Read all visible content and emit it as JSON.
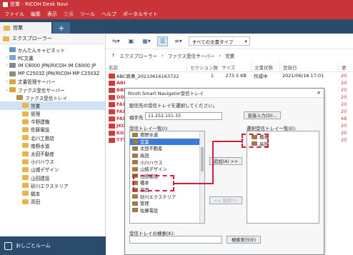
{
  "app": {
    "title": "営業 - RICOH Desk Navi"
  },
  "menu": {
    "items": [
      "ファイル",
      "編集",
      "表示",
      "文書",
      "ツール",
      "ヘルプ",
      "ポータルサイト"
    ]
  },
  "tab": {
    "label": "営業",
    "add": "+"
  },
  "left": {
    "header": "エクスプローラー",
    "tree": [
      {
        "label": "かんたんキャビネット",
        "icon": "cabinet-icon",
        "arrow": ""
      },
      {
        "label": "PC文書",
        "icon": "pc-icon",
        "arrow": "›"
      },
      {
        "label": "IM C6000 JPN(RICOH IM C6000 JP",
        "icon": "printer-icon",
        "arrow": "›"
      },
      {
        "label": "MP C2503Z JPN(RICOH MP C2503Z",
        "icon": "printer-icon",
        "arrow": "›"
      },
      {
        "label": "文書管理サーバー",
        "icon": "server-icon",
        "arrow": "›"
      },
      {
        "label": "ファクス受信サーバー",
        "icon": "fax-server-icon",
        "arrow": "⌄"
      },
      {
        "label": "ファクス受信トレイ",
        "icon": "tray-icon",
        "arrow": ""
      },
      {
        "label": "営業",
        "icon": "folder-icon",
        "arrow": ""
      },
      {
        "label": "管理",
        "icon": "folder-icon",
        "arrow": ""
      },
      {
        "label": "今野建機",
        "icon": "folder-icon",
        "arrow": ""
      },
      {
        "label": "佐藤電設",
        "icon": "folder-icon",
        "arrow": ""
      },
      {
        "label": "北川工務店",
        "icon": "folder-icon",
        "arrow": ""
      },
      {
        "label": "南野水道",
        "icon": "folder-icon",
        "arrow": ""
      },
      {
        "label": "太田不動産",
        "icon": "folder-icon",
        "arrow": ""
      },
      {
        "label": "小川ハウス",
        "icon": "folder-icon",
        "arrow": ""
      },
      {
        "label": "山城デザイン",
        "icon": "folder-icon",
        "arrow": ""
      },
      {
        "label": "山田建設",
        "icon": "folder-icon",
        "arrow": ""
      },
      {
        "label": "砂川エクステリア",
        "icon": "folder-icon",
        "arrow": ""
      },
      {
        "label": "橋本",
        "icon": "folder-icon",
        "arrow": ""
      },
      {
        "label": "高田",
        "icon": "folder-icon",
        "arrow": ""
      }
    ],
    "footer": "おしごとルーム"
  },
  "right": {
    "doc_type_select": "すべての文書タイプ",
    "breadcrumb": [
      "↑",
      "エクスプローラー",
      "›",
      "ファクス受信サーバー",
      "›",
      "営業"
    ],
    "columns": [
      "名前",
      "セクション数",
      "サイズ",
      "文書状態",
      "登録日",
      "更"
    ],
    "rows": [
      {
        "name": "ABC商事_20210616163722",
        "sections": "1",
        "size": "273.5 KB",
        "status": "作成中",
        "date": "2021/06/16 17:01",
        "extra": "20"
      },
      {
        "name": "ABI",
        "sections": "",
        "size": "",
        "status": "",
        "date": "",
        "extra": "20"
      },
      {
        "name": "BBI",
        "sections": "",
        "size": "",
        "status": "",
        "date": "",
        "extra": "20"
      },
      {
        "name": "DDI",
        "sections": "",
        "size": "",
        "status": "",
        "date": "",
        "extra": "20"
      },
      {
        "name": "FAX",
        "sections": "",
        "size": "",
        "status": "",
        "date": "",
        "extra": "20"
      },
      {
        "name": "FAX",
        "sections": "",
        "size": "",
        "status": "",
        "date": "",
        "extra": "20"
      },
      {
        "name": "FAX",
        "sections": "",
        "size": "",
        "status": "",
        "date": "",
        "extra": "48"
      },
      {
        "name": "JKC",
        "sections": "",
        "size": "",
        "status": "",
        "date": "",
        "extra": "20"
      },
      {
        "name": "KGS",
        "sections": "",
        "size": "",
        "status": "",
        "date": "",
        "extra": "20"
      },
      {
        "name": "TTT",
        "sections": "",
        "size": "",
        "status": "",
        "date": "",
        "extra": "20"
      }
    ]
  },
  "dialog": {
    "title": "Ricoh Smart Navigator受信トレイ",
    "close": "✕",
    "instruction": "配信先の受信トレイを選択してください。",
    "fax_label": "相手先",
    "fax_value": "11.252.151.33",
    "direct_button": "直接入力(D)...",
    "list_label": "受信トレイ一覧(I):",
    "selected_label": "選択受信トレイ一覧(E):",
    "list_items": [
      "南野水道",
      "営業",
      "太田不動産",
      "高田",
      "小川ハウス",
      "山城デザイン",
      "山田建設",
      "橋本",
      "高田",
      "砂川エクステリア",
      "管理",
      "佐藤電設"
    ],
    "selected_items": [
      "橋本",
      "高田"
    ],
    "add_button": "追加(A) >>",
    "delete_button": "<< 削除(Y)",
    "search_label": "受信トレイの検索(K):",
    "search_value": "",
    "search_button": "検索実行(E)"
  }
}
